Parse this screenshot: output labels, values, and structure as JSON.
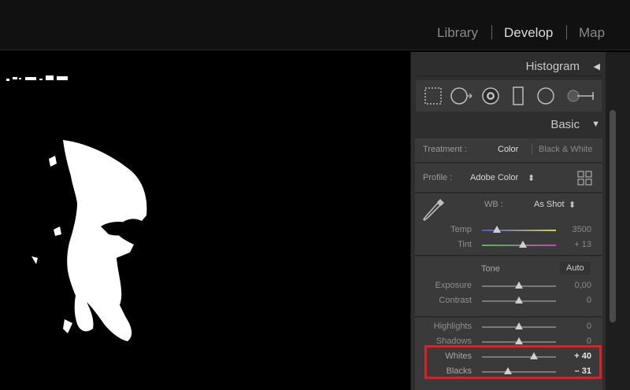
{
  "modules": {
    "library": "Library",
    "develop": "Develop",
    "map": "Map"
  },
  "panels": {
    "histogram": "Histogram",
    "basic": "Basic"
  },
  "basic": {
    "treatment_label": "Treatment :",
    "treatment_color": "Color",
    "treatment_bw": "Black & White",
    "profile_label": "Profile :",
    "profile_value": "Adobe Color",
    "profile_arrows": "⬍",
    "wb_label": "WB :",
    "wb_value": "As Shot",
    "wb_arrows": "⬍",
    "tone_label": "Tone",
    "auto_label": "Auto",
    "sliders": [
      {
        "label": "Temp",
        "value": "3500",
        "position": 0.2
      },
      {
        "label": "Tint",
        "value": "+ 13",
        "position": 0.55
      },
      {
        "label": "Exposure",
        "value": "0,00",
        "position": 0.5
      },
      {
        "label": "Contrast",
        "value": "0",
        "position": 0.5
      },
      {
        "label": "Highlights",
        "value": "0",
        "position": 0.5
      },
      {
        "label": "Shadows",
        "value": "0",
        "position": 0.5
      },
      {
        "label": "Whites",
        "value": "+ 40",
        "position": 0.7
      },
      {
        "label": "Blacks",
        "value": "– 31",
        "position": 0.35
      }
    ]
  },
  "icons": {
    "histogram_toggle": "triangle-left-icon",
    "basic_toggle": "triangle-down-icon",
    "tools": [
      "crop-icon",
      "spot-removal-icon",
      "red-eye-icon",
      "graduated-filter-icon",
      "radial-filter-icon",
      "adjustment-brush-icon"
    ],
    "eyedropper": "eyedropper-icon",
    "profile_browser": "grid-icon"
  },
  "colors": {
    "highlight": "#e31e24",
    "panel": "#3a3a3a",
    "background": "#000000"
  }
}
